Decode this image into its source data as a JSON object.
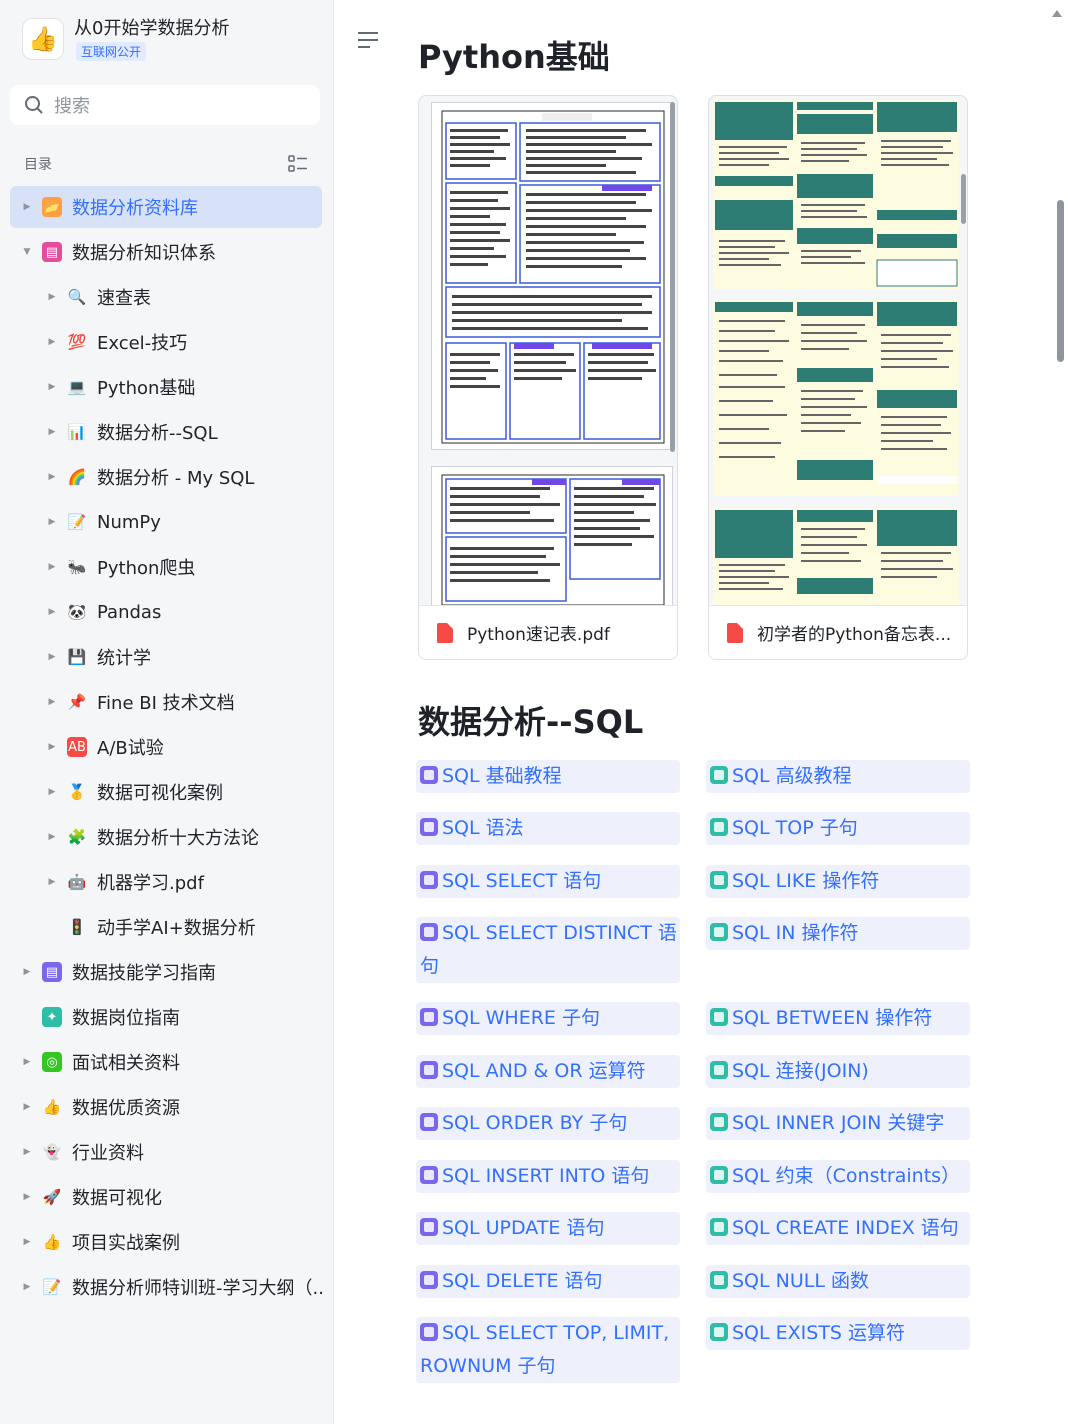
{
  "workspace": {
    "title": "从0开始学数据分析",
    "badge": "互联网公开",
    "logo_icon": "thumbs-up-icon"
  },
  "search": {
    "placeholder": "搜索"
  },
  "toc": {
    "label": "目录"
  },
  "sidebar": {
    "items": [
      {
        "label": "数据分析资料库",
        "level": 1,
        "icon": "folder-icon",
        "active": true
      },
      {
        "label": "数据分析知识体系",
        "level": 1,
        "icon": "book-icon",
        "expanded": true
      },
      {
        "label": "速查表",
        "level": 2,
        "icon": "magnifier-icon"
      },
      {
        "label": "Excel-技巧",
        "level": 2,
        "icon": "hundred-points-icon"
      },
      {
        "label": "Python基础",
        "level": 2,
        "icon": "laptop-icon"
      },
      {
        "label": "数据分析--SQL",
        "level": 2,
        "icon": "bar-chart-icon"
      },
      {
        "label": "数据分析 - My SQL",
        "level": 2,
        "icon": "rainbow-icon"
      },
      {
        "label": "NumPy",
        "level": 2,
        "icon": "memo-icon"
      },
      {
        "label": "Python爬虫",
        "level": 2,
        "icon": "bug-icon"
      },
      {
        "label": "Pandas",
        "level": 2,
        "icon": "panda-icon"
      },
      {
        "label": "统计学",
        "level": 2,
        "icon": "floppy-disk-icon"
      },
      {
        "label": "Fine BI 技术文档",
        "level": 2,
        "icon": "pushpin-icon"
      },
      {
        "label": "A/B试验",
        "level": 2,
        "icon": "ab-button-icon"
      },
      {
        "label": "数据可视化案例",
        "level": 2,
        "icon": "medal-icon"
      },
      {
        "label": "数据分析十大方法论",
        "level": 2,
        "icon": "puzzle-icon"
      },
      {
        "label": "机器学习.pdf",
        "level": 2,
        "icon": "robot-icon"
      },
      {
        "label": "动手学AI+数据分析",
        "level": 2,
        "icon": "traffic-light-icon",
        "no_arrow": true
      },
      {
        "label": "数据技能学习指南",
        "level": 1,
        "icon": "doc-icon"
      },
      {
        "label": "数据岗位指南",
        "level": 1,
        "icon": "sparkle-doc-icon",
        "no_arrow": true
      },
      {
        "label": "面试相关资料",
        "level": 1,
        "icon": "target-icon"
      },
      {
        "label": "数据优质资源",
        "level": 1,
        "icon": "thumbs-up-icon"
      },
      {
        "label": "行业资料",
        "level": 1,
        "icon": "ghost-icon"
      },
      {
        "label": "数据可视化",
        "level": 1,
        "icon": "rocket-icon"
      },
      {
        "label": "项目实战案例",
        "level": 1,
        "icon": "thumbs-up-icon"
      },
      {
        "label": "数据分析师特训班-学习大纲（...",
        "level": 1,
        "icon": "memo-icon"
      }
    ]
  },
  "main": {
    "section1_title": "Python基础",
    "files": [
      {
        "name": "Python速记表.pdf"
      },
      {
        "name": "初学者的Python备忘表..."
      }
    ],
    "section2_title": "数据分析--SQL",
    "links_left": [
      "SQL 基础教程",
      "SQL 语法",
      "SQL SELECT 语句",
      "SQL SELECT DISTINCT 语句",
      "SQL WHERE 子句",
      "SQL AND & OR 运算符",
      "SQL ORDER BY 子句",
      "SQL INSERT INTO 语句",
      "SQL UPDATE 语句",
      "SQL DELETE 语句",
      "SQL SELECT TOP, LIMIT, ROWNUM 子句"
    ],
    "links_right": [
      "SQL 高级教程",
      "SQL TOP 子句",
      "SQL LIKE 操作符",
      "SQL IN 操作符",
      "SQL BETWEEN 操作符",
      "SQL 连接(JOIN)",
      "SQL INNER JOIN 关键字",
      "SQL 约束（Constraints）",
      "SQL CREATE INDEX 语句",
      "SQL NULL 函数",
      "SQL EXISTS 运算符"
    ]
  },
  "colors": {
    "accent": "#3370ff",
    "active_bg": "#d7e1f7",
    "link_bg": "#eef0fb"
  }
}
